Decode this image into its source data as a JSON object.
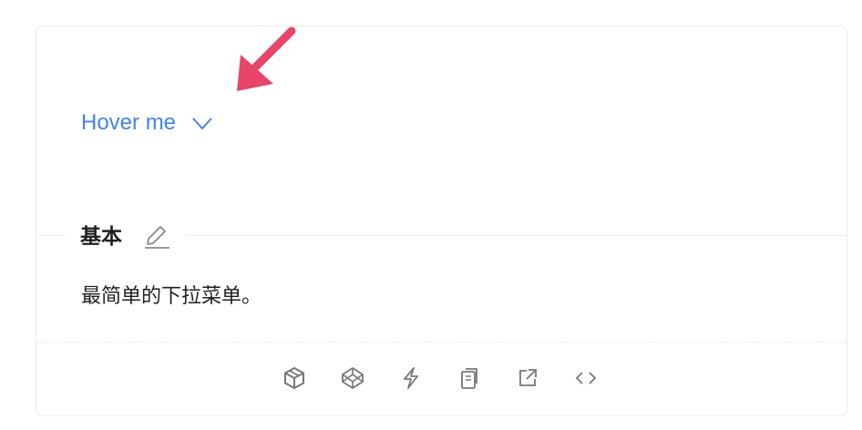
{
  "dropdown": {
    "label": "Hover me",
    "color": "#4383ec"
  },
  "section": {
    "title": "基本",
    "description": "最简单的下拉菜单。"
  },
  "annotation": {
    "arrow_color": "#e8456a"
  },
  "actions": [
    {
      "icon": "codesandbox-icon"
    },
    {
      "icon": "codepen-icon"
    },
    {
      "icon": "lightning-icon"
    },
    {
      "icon": "copy-icon"
    },
    {
      "icon": "open-external-icon"
    },
    {
      "icon": "code-icon"
    }
  ]
}
